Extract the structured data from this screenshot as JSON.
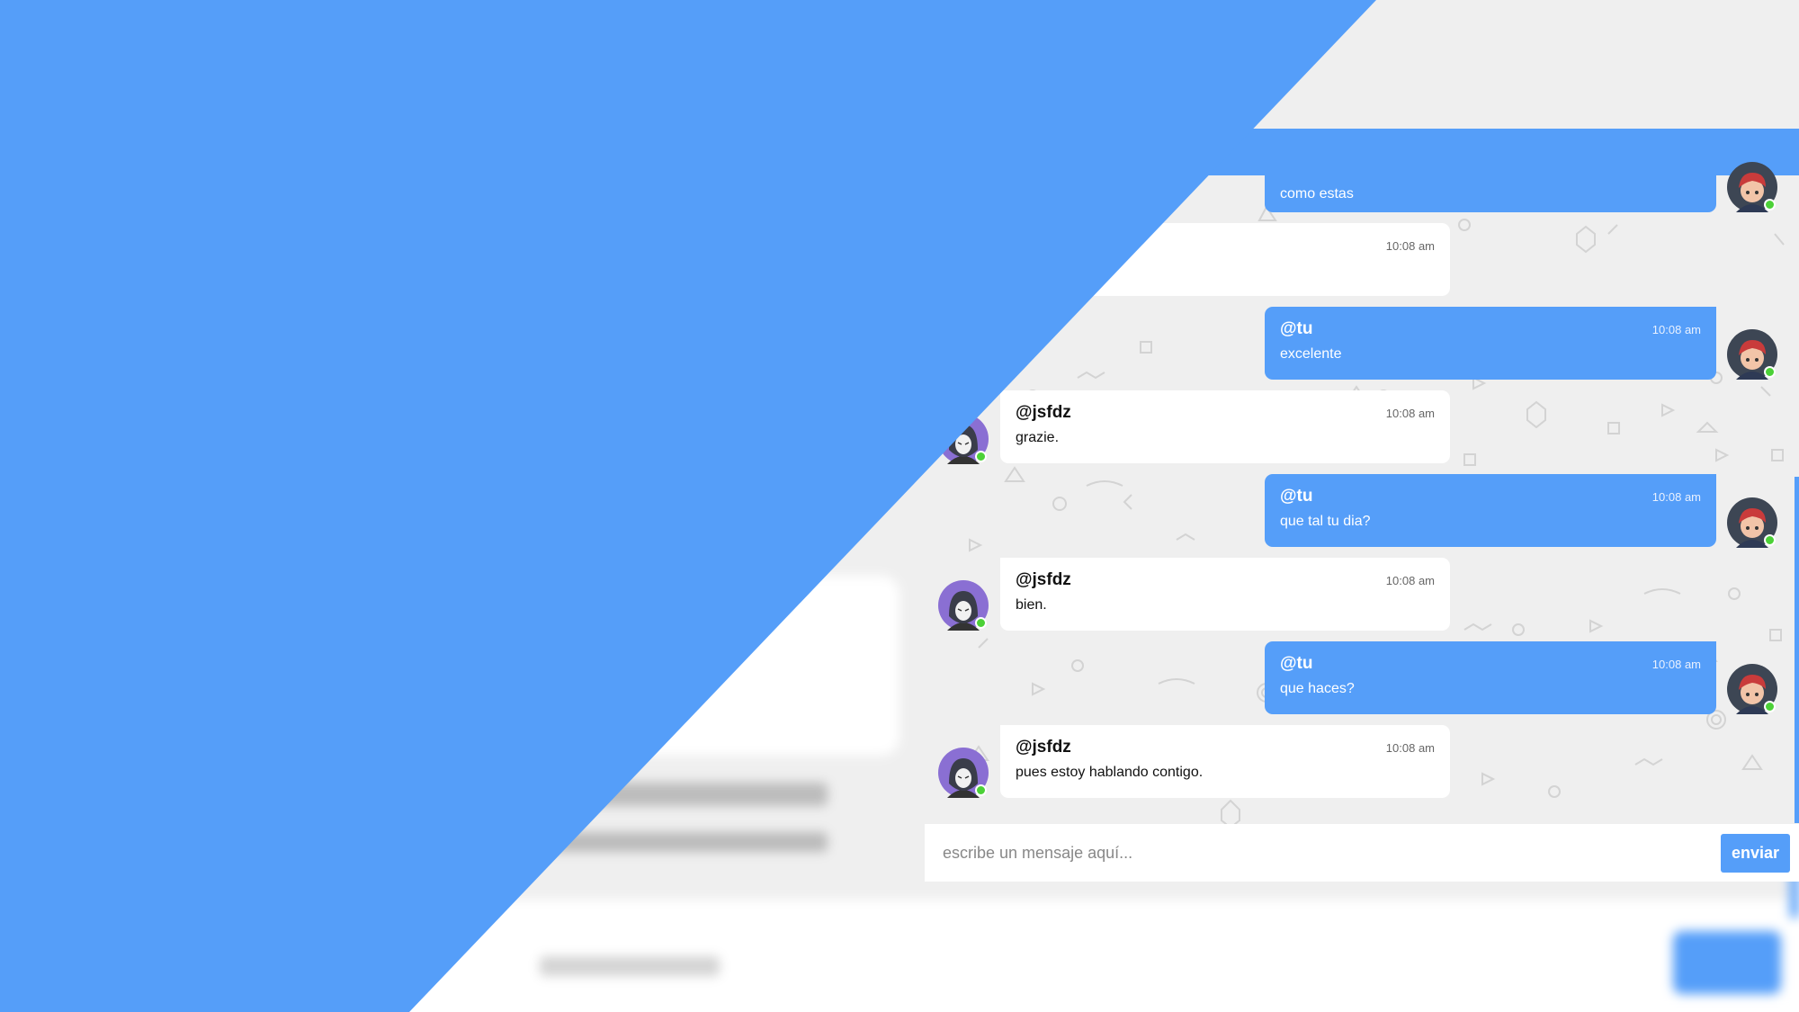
{
  "colors": {
    "accent": "#559ef9",
    "background": "#efefef",
    "online": "#4cd137"
  },
  "messages": [
    {
      "sender": "mine",
      "user": "",
      "time": "",
      "text": "como estas"
    },
    {
      "sender": "theirs",
      "user": "",
      "time": "10:08 am",
      "text": ""
    },
    {
      "sender": "mine",
      "user": "@tu",
      "time": "10:08 am",
      "text": "excelente"
    },
    {
      "sender": "theirs",
      "user": "@jsfdz",
      "time": "10:08 am",
      "text": "grazie."
    },
    {
      "sender": "mine",
      "user": "@tu",
      "time": "10:08 am",
      "text": "que tal tu dia?"
    },
    {
      "sender": "theirs",
      "user": "@jsfdz",
      "time": "10:08 am",
      "text": "bien."
    },
    {
      "sender": "mine",
      "user": "@tu",
      "time": "10:08 am",
      "text": "que haces?"
    },
    {
      "sender": "theirs",
      "user": "@jsfdz",
      "time": "10:08 am",
      "text": "pues estoy hablando contigo."
    }
  ],
  "composer": {
    "placeholder": "escribe un mensaje aquí...",
    "send_label": "enviar"
  },
  "icons": {
    "my_avatar": "red-hair-boy-avatar-icon",
    "their_avatar": "hooded-anonymous-avatar-icon",
    "online": "online-status-dot"
  }
}
